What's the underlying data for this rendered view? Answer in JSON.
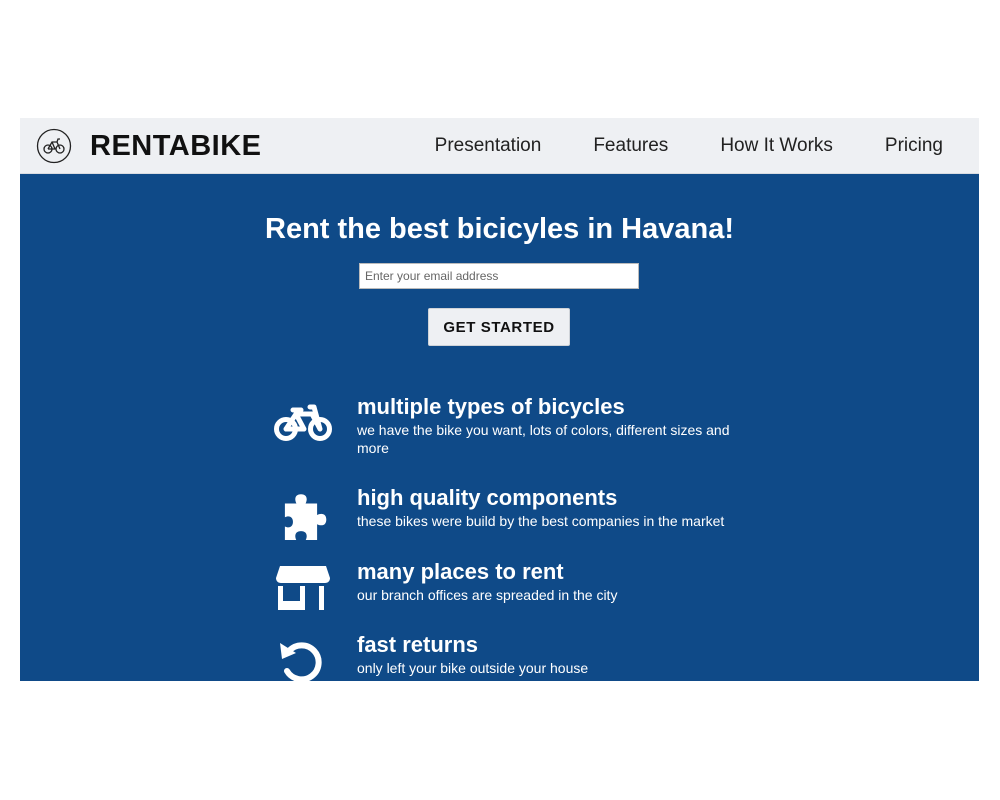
{
  "navbar": {
    "brand": "RENTABIKE",
    "logo_icon": "bike-logo-icon",
    "links": [
      "Presentation",
      "Features",
      "How It Works",
      "Pricing"
    ]
  },
  "hero": {
    "title": "Rent the best bicicyles in Havana!",
    "email_placeholder": "Enter your email address",
    "email_value": "",
    "cta_label": "GET STARTED"
  },
  "features": [
    {
      "icon": "bicycle-icon",
      "title": "multiple types of bicycles",
      "desc": "we have the bike you want, lots of colors, different sizes and more"
    },
    {
      "icon": "puzzle-piece-icon",
      "title": "high quality components",
      "desc": "these bikes were build by the best companies in the market"
    },
    {
      "icon": "store-icon",
      "title": "many places to rent",
      "desc": "our branch offices are spreaded in the city"
    },
    {
      "icon": "undo-arrow-icon",
      "title": "fast returns",
      "desc": "only left your bike outside your house"
    }
  ],
  "colors": {
    "hero_background": "#0f4a88",
    "navbar_background": "#eef0f3",
    "text_light": "#ffffff",
    "text_dark": "#111111"
  }
}
